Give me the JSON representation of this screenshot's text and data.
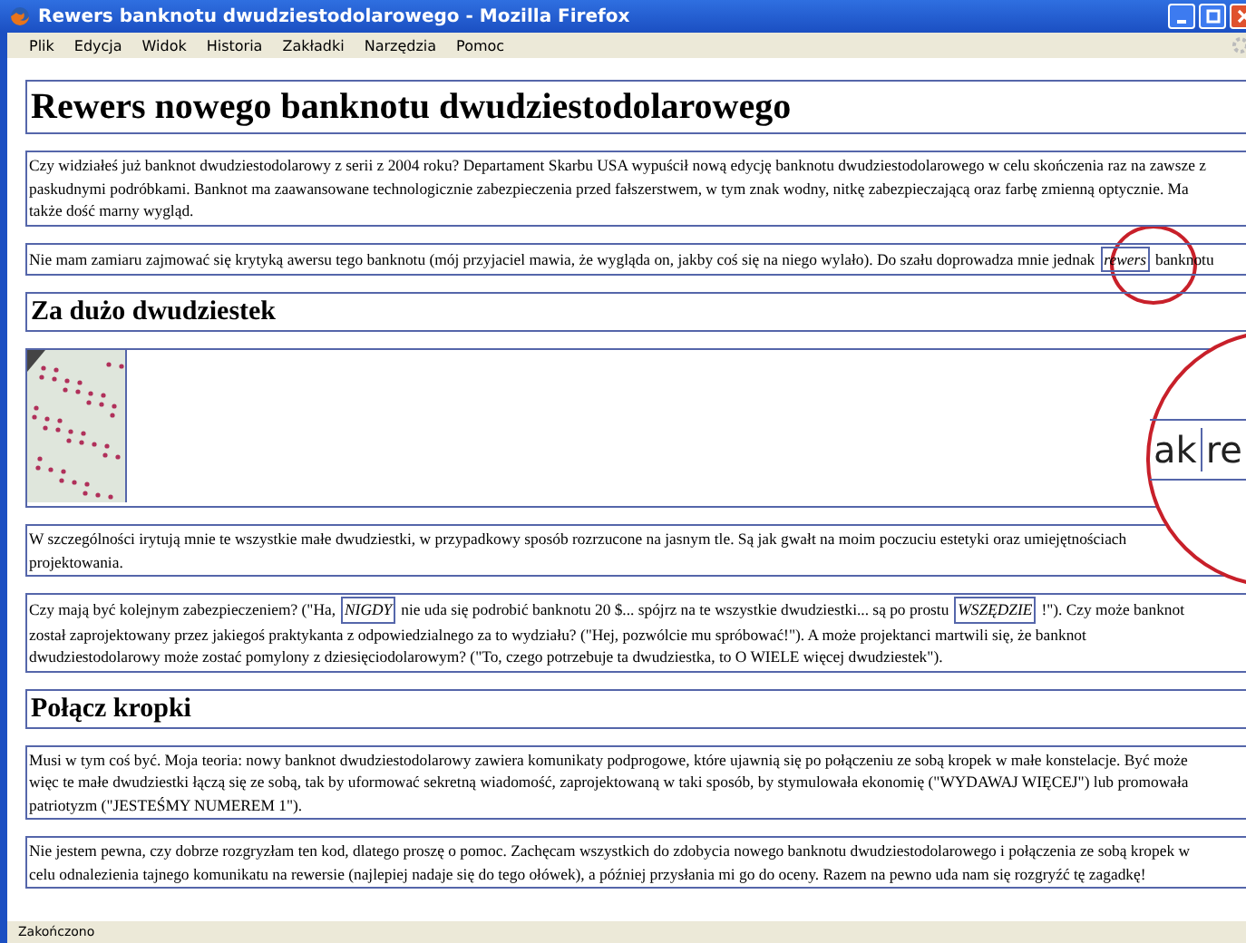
{
  "window": {
    "title": "Rewers banknotu dwudziestodolarowego - Mozilla Firefox"
  },
  "menu": [
    "Plik",
    "Edycja",
    "Widok",
    "Historia",
    "Zakładki",
    "Narzędzia",
    "Pomoc"
  ],
  "content": [
    {
      "kind": "h1",
      "text": "Rewers nowego banknotu dwudziestodolarowego"
    },
    {
      "kind": "p",
      "lines": [
        [
          {
            "kind": "plain",
            "text": "Czy widziałeś już banknot dwudziestodolarowy z serii z 2004 roku? Departament Skarbu USA wypuścił nową edycję banknotu dwudziestodolarowego w celu skończenia raz na zawsze z"
          }
        ],
        [
          {
            "kind": "plain",
            "text": "paskudnymi podróbkami. Banknot ma zaawansowane technologicznie zabezpieczenia przed fałszerstwem, w tym znak wodny, nitkę zabezpieczającą oraz farbę zmienną optycznie. Ma"
          }
        ],
        [
          {
            "kind": "plain",
            "text": "także dość marny wygląd."
          }
        ]
      ]
    },
    {
      "kind": "p",
      "lines": [
        [
          {
            "kind": "plain",
            "text": "Nie mam zamiaru zajmować się krytyką awersu tego banknotu (mój przyjaciel mawia, że wygląda on, jakby coś się na niego wylało). Do szału doprowadza mnie jednak"
          },
          {
            "kind": "boxed",
            "text": "rewers"
          },
          {
            "kind": "plain",
            "text": "banknotu"
          }
        ]
      ]
    },
    {
      "kind": "h2",
      "text": "Za dużo dwudziestek"
    },
    {
      "kind": "image"
    },
    {
      "kind": "p",
      "lines": [
        [
          {
            "kind": "plain",
            "text": "W szczególności irytują mnie te wszystkie małe dwudziestki, w przypadkowy sposób rozrzucone na jasnym tle. Są jak gwałt na moim poczuciu estetyki oraz umiejętnościach"
          }
        ],
        [
          {
            "kind": "plain",
            "text": "projektowania."
          }
        ]
      ]
    },
    {
      "kind": "p",
      "lines": [
        [
          {
            "kind": "plain",
            "text": "Czy mają być kolejnym zabezpieczeniem? (\"Ha,"
          },
          {
            "kind": "boxed",
            "text": "NIGDY"
          },
          {
            "kind": "plain",
            "text": "nie uda się podrobić banknotu 20 $... spójrz na te wszystkie dwudziestki... są po prostu"
          },
          {
            "kind": "boxed",
            "text": "WSZĘDZIE"
          },
          {
            "kind": "plain",
            "text": "!\"). Czy może banknot"
          }
        ],
        [
          {
            "kind": "plain",
            "text": "został zaprojektowany przez jakiegoś praktykanta z odpowiedzialnego za to wydziału? (\"Hej, pozwólcie mu spróbować!\"). A może projektanci martwili się, że banknot"
          }
        ],
        [
          {
            "kind": "plain",
            "text": "dwudziestodolarowy może zostać pomylony z dziesięciodolarowym? (\"To, czego potrzebuje ta dwudziestka, to O WIELE więcej dwudziestek\")."
          }
        ]
      ]
    },
    {
      "kind": "h2",
      "text": "Połącz kropki"
    },
    {
      "kind": "p",
      "lines": [
        [
          {
            "kind": "plain",
            "text": "Musi w tym coś być. Moja teoria: nowy banknot dwudziestodolarowy zawiera komunikaty podprogowe, które ujawnią się po połączeniu ze sobą kropek w małe konstelacje. Być może"
          }
        ],
        [
          {
            "kind": "plain",
            "text": "więc te małe dwudziestki łączą się ze sobą, tak by uformować sekretną wiadomość, zaprojektowaną w taki sposób, by stymulowała ekonomię (\"WYDAWAJ WIĘCEJ\") lub promowała"
          }
        ],
        [
          {
            "kind": "plain",
            "text": "patriotyzm (\"JESTEŚMY NUMEREM 1\")."
          }
        ]
      ]
    },
    {
      "kind": "p",
      "lines": [
        [
          {
            "kind": "plain",
            "text": "Nie jestem pewna, czy dobrze rozgryzłam ten kod, dlatego proszę o pomoc. Zachęcam wszystkich do zdobycia nowego banknotu dwudziestodolarowego i połączenia ze sobą kropek w"
          }
        ],
        [
          {
            "kind": "plain",
            "text": "celu odnalezienia tajnego komunikatu na rewersie (najlepiej nadaje się do tego ołówek), a później przysłania mi go do oceny. Razem na pewno uda nam się rozgryźć tę zagadkę!"
          }
        ]
      ]
    }
  ],
  "magnifier": [
    "ak",
    "re"
  ],
  "status_bar": "Zakończono"
}
